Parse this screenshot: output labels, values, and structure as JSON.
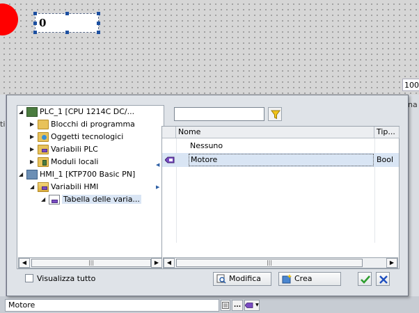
{
  "canvas": {
    "io_field_value": "0",
    "zoom_value": "100"
  },
  "background": {
    "left_strip_text": "ti",
    "right_strip_text": "na"
  },
  "tree": {
    "items": [
      {
        "label": "PLC_1 [CPU 1214C DC/...",
        "expanded": true,
        "icon": "plc-icon"
      },
      {
        "label": "Blocchi di programma",
        "expanded": false,
        "icon": "folder-icon"
      },
      {
        "label": "Oggetti tecnologici",
        "expanded": false,
        "icon": "gear-folder-icon"
      },
      {
        "label": "Variabili PLC",
        "expanded": false,
        "icon": "tag-folder-icon"
      },
      {
        "label": "Moduli locali",
        "expanded": false,
        "icon": "module-folder-icon"
      },
      {
        "label": "HMI_1 [KTP700 Basic PN]",
        "expanded": true,
        "icon": "hmi-icon"
      },
      {
        "label": "Variabili HMI",
        "expanded": true,
        "icon": "tag-folder-icon"
      },
      {
        "label": "Tabella delle varia...",
        "expanded": true,
        "icon": "tag-table-icon",
        "selected": true
      }
    ]
  },
  "filter": {
    "value": ""
  },
  "list": {
    "headers": {
      "name": "Nome",
      "type": "Tip..."
    },
    "rows": [
      {
        "name": "Nessuno",
        "type": "",
        "selected": false
      },
      {
        "name": "Motore",
        "type": "Bool",
        "selected": true
      }
    ]
  },
  "footer": {
    "show_all_label": "Visualizza tutto",
    "edit_label": "Modifica",
    "create_label": "Crea"
  },
  "bottom": {
    "field_value": "Motore",
    "ellipsis_label": "..."
  },
  "colors": {
    "indicator": "#ff0000",
    "selection": "#d9e5f4",
    "ok_green": "#2e9e2e",
    "cancel_blue": "#1f4fbf"
  }
}
